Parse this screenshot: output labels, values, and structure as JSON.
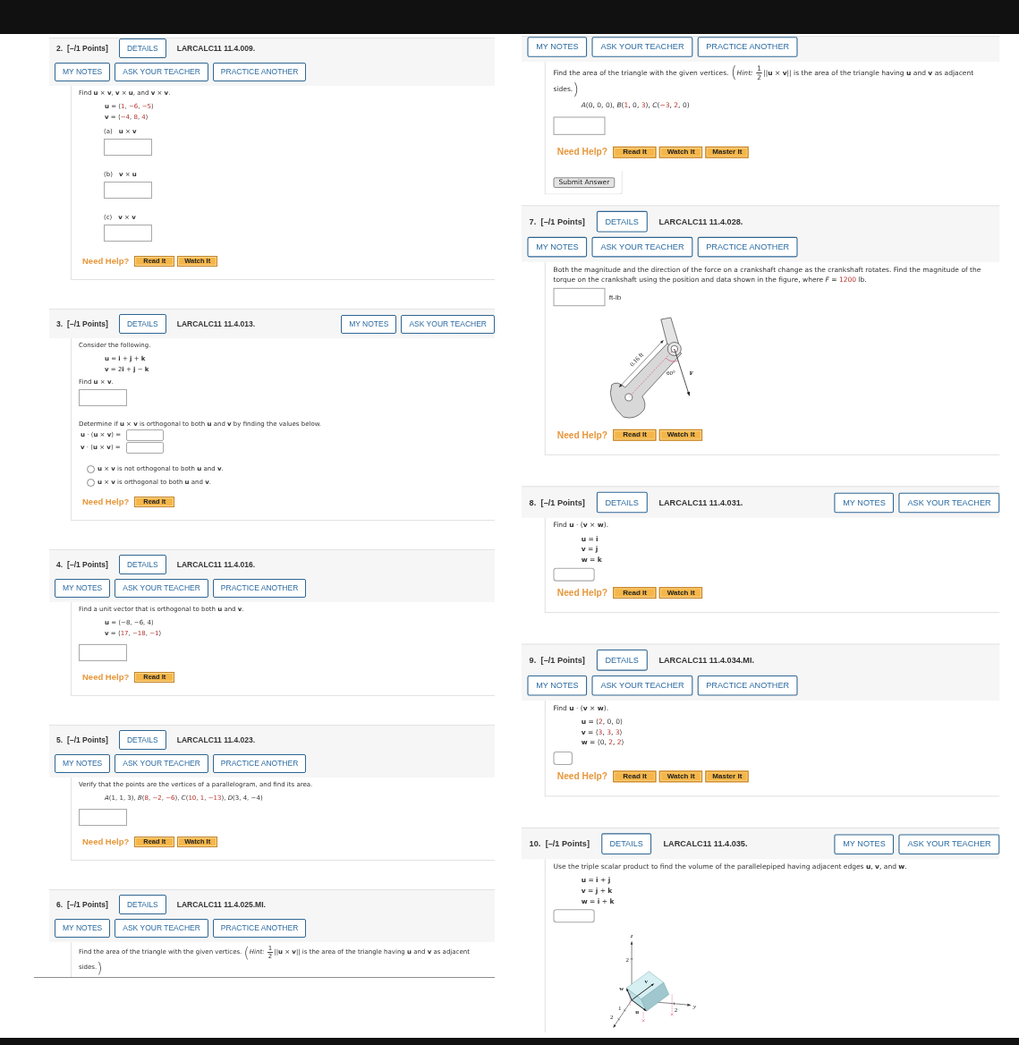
{
  "columns": [
    {
      "questions": [
        {
          "number": "2.",
          "points": "[–/1 Points]",
          "details": "DETAILS",
          "code": "LARCALC11 11.4.009.",
          "actions": [
            "MY NOTES",
            "ASK YOUR TEACHER",
            "PRACTICE ANOTHER"
          ],
          "body": [
            {
              "kind": "text",
              "parts": [
                {
                  "kind": "text",
                  "text": "Find **u** × **v**, **v** × **u**, and **v** × **v**."
                }
              ]
            },
            {
              "kind": "math",
              "lines": [
                [
                  {
                    "kind": "text",
                    "text": "**u** = ⟨"
                  },
                  {
                    "kind": "value",
                    "text": "1"
                  },
                  {
                    "kind": "text",
                    "text": ", "
                  },
                  {
                    "kind": "value",
                    "text": "−6"
                  },
                  {
                    "kind": "text",
                    "text": ", "
                  },
                  {
                    "kind": "value",
                    "text": "−5"
                  },
                  {
                    "kind": "text",
                    "text": "⟩"
                  }
                ],
                [
                  {
                    "kind": "text",
                    "text": "**v** = ⟨"
                  },
                  {
                    "kind": "value",
                    "text": "−4"
                  },
                  {
                    "kind": "text",
                    "text": ", "
                  },
                  {
                    "kind": "value",
                    "text": "8"
                  },
                  {
                    "kind": "text",
                    "text": ", "
                  },
                  {
                    "kind": "value",
                    "text": "4"
                  },
                  {
                    "kind": "text",
                    "text": "⟩"
                  }
                ]
              ]
            },
            {
              "kind": "subpart",
              "label": "(a)",
              "expr": "**u** × **v**"
            },
            {
              "kind": "subpart",
              "label": "(b)",
              "expr": "**v** × **u**"
            },
            {
              "kind": "subpart",
              "label": "(c)",
              "expr": "**v** × **v**"
            }
          ],
          "help": {
            "label": "Need Help?",
            "buttons": [
              "Read It",
              "Watch It"
            ]
          }
        },
        {
          "number": "3.",
          "points": "[–/1 Points]",
          "details": "DETAILS",
          "code": "LARCALC11 11.4.013.",
          "header_actions": [
            "MY NOTES",
            "ASK YOUR TEACHER"
          ],
          "body": [
            {
              "kind": "text",
              "parts": [
                {
                  "kind": "text",
                  "text": "Consider the following."
                }
              ]
            },
            {
              "kind": "math",
              "lines": [
                [
                  {
                    "kind": "text",
                    "text": "**u** = **i** + **j** + **k**"
                  }
                ],
                [
                  {
                    "kind": "text",
                    "text": "**v** = 2**i** + **j** − **k**"
                  }
                ]
              ]
            },
            {
              "kind": "text",
              "parts": [
                {
                  "kind": "text",
                  "text": "Find **u** × **v**."
                }
              ]
            },
            {
              "kind": "answer"
            },
            {
              "kind": "text",
              "parts": [
                {
                  "kind": "text",
                  "text": "Determine if **u** × **v** is orthogonal to both **u** and **v** by finding the values below."
                }
              ]
            },
            {
              "kind": "inline_answer",
              "label": "**u** · (**u** × **v**) ="
            },
            {
              "kind": "inline_answer",
              "label": "**v** · (**u** × **v**) ="
            },
            {
              "kind": "radio",
              "label": "**u** × **v** is not orthogonal to both **u** and **v**.",
              "selected": false
            },
            {
              "kind": "radio",
              "label": "**u** × **v** is orthogonal to both **u** and **v**.",
              "selected": false
            }
          ],
          "help": {
            "label": "Need Help?",
            "buttons": [
              "Read It"
            ]
          }
        },
        {
          "number": "4.",
          "points": "[–/1 Points]",
          "details": "DETAILS",
          "code": "LARCALC11 11.4.016.",
          "actions": [
            "MY NOTES",
            "ASK YOUR TEACHER",
            "PRACTICE ANOTHER"
          ],
          "body": [
            {
              "kind": "text",
              "parts": [
                {
                  "kind": "text",
                  "text": "Find a unit vector that is orthogonal to both **u** and **v**."
                }
              ]
            },
            {
              "kind": "math",
              "lines": [
                [
                  {
                    "kind": "text",
                    "text": "**u** = ⟨−8, −6, 4⟩"
                  }
                ],
                [
                  {
                    "kind": "text",
                    "text": "**v** = ⟨"
                  },
                  {
                    "kind": "value",
                    "text": "17"
                  },
                  {
                    "kind": "text",
                    "text": ", "
                  },
                  {
                    "kind": "value",
                    "text": "−18"
                  },
                  {
                    "kind": "text",
                    "text": ", "
                  },
                  {
                    "kind": "value",
                    "text": "−1"
                  },
                  {
                    "kind": "text",
                    "text": "⟩"
                  }
                ]
              ]
            },
            {
              "kind": "answer"
            }
          ],
          "help": {
            "label": "Need Help?",
            "buttons": [
              "Read It"
            ]
          }
        },
        {
          "number": "5.",
          "points": "[–/1 Points]",
          "details": "DETAILS",
          "code": "LARCALC11 11.4.023.",
          "actions": [
            "MY NOTES",
            "ASK YOUR TEACHER",
            "PRACTICE ANOTHER"
          ],
          "body": [
            {
              "kind": "text",
              "parts": [
                {
                  "kind": "text",
                  "text": "Verify that the points are the vertices of a parallelogram, and find its area."
                }
              ]
            },
            {
              "kind": "math",
              "lines": [
                [
                  {
                    "kind": "text",
                    "text": "*A*(1, 1, 3), *B*("
                  },
                  {
                    "kind": "value",
                    "text": "8"
                  },
                  {
                    "kind": "text",
                    "text": ", "
                  },
                  {
                    "kind": "value",
                    "text": "−2"
                  },
                  {
                    "kind": "text",
                    "text": ", "
                  },
                  {
                    "kind": "value",
                    "text": "−6"
                  },
                  {
                    "kind": "text",
                    "text": "), *C*("
                  },
                  {
                    "kind": "value",
                    "text": "10"
                  },
                  {
                    "kind": "text",
                    "text": ", "
                  },
                  {
                    "kind": "value",
                    "text": "1"
                  },
                  {
                    "kind": "text",
                    "text": ", "
                  },
                  {
                    "kind": "value",
                    "text": "−13"
                  },
                  {
                    "kind": "text",
                    "text": "), *D*(3, 4, −4)"
                  }
                ]
              ]
            },
            {
              "kind": "answer"
            }
          ],
          "help": {
            "label": "Need Help?",
            "buttons": [
              "Read It",
              "Watch It"
            ]
          }
        },
        {
          "number": "6.",
          "points": "[–/1 Points]",
          "details": "DETAILS",
          "code": "LARCALC11 11.4.025.MI.",
          "actions": [
            "MY NOTES",
            "ASK YOUR TEACHER",
            "PRACTICE ANOTHER"
          ],
          "body": [
            {
              "kind": "text",
              "parts": [
                {
                  "kind": "text",
                  "text": "Find the area of the triangle with the given vertices. "
                },
                {
                  "kind": "paren",
                  "text": "("
                },
                {
                  "kind": "text",
                  "text": "*Hint:* "
                },
                {
                  "kind": "frac",
                  "num": "1",
                  "den": "2"
                },
                {
                  "kind": "text",
                  "text": "||**u** × **v**||  is the area of the triangle having **u** and **v** as adjacent sides."
                },
                {
                  "kind": "paren",
                  "text": ")"
                }
              ]
            }
          ]
        }
      ]
    },
    {
      "questions": [
        {
          "actions": [
            "MY NOTES",
            "ASK YOUR TEACHER",
            "PRACTICE ANOTHER"
          ],
          "body": [
            {
              "kind": "text",
              "parts": [
                {
                  "kind": "text",
                  "text": "Find the area of the triangle with the given vertices. "
                },
                {
                  "kind": "paren",
                  "text": "("
                },
                {
                  "kind": "text",
                  "text": "*Hint:* "
                },
                {
                  "kind": "frac",
                  "num": "1",
                  "den": "2"
                },
                {
                  "kind": "text",
                  "text": "||**u** × **v**||  is the area of the triangle having **u** and **v** as adjacent sides."
                },
                {
                  "kind": "paren",
                  "text": ")"
                }
              ]
            },
            {
              "kind": "math",
              "lines": [
                [
                  {
                    "kind": "text",
                    "text": "*A*(0, 0, 0), *B*("
                  },
                  {
                    "kind": "value",
                    "text": "1"
                  },
                  {
                    "kind": "text",
                    "text": ", 0, "
                  },
                  {
                    "kind": "value",
                    "text": "3"
                  },
                  {
                    "kind": "text",
                    "text": "), *C*("
                  },
                  {
                    "kind": "value",
                    "text": "−3"
                  },
                  {
                    "kind": "text",
                    "text": ", "
                  },
                  {
                    "kind": "value",
                    "text": "2"
                  },
                  {
                    "kind": "text",
                    "text": ", 0)"
                  }
                ]
              ]
            },
            {
              "kind": "answer"
            }
          ],
          "help": {
            "label": "Need Help?",
            "buttons": [
              "Read It",
              "Watch It",
              "Master It"
            ]
          },
          "submit": "Submit Answer"
        },
        {
          "number": "7.",
          "points": "[–/1 Points]",
          "details": "DETAILS",
          "code": "LARCALC11 11.4.028.",
          "actions": [
            "MY NOTES",
            "ASK YOUR TEACHER",
            "PRACTICE ANOTHER"
          ],
          "body": [
            {
              "kind": "text",
              "parts": [
                {
                  "kind": "text",
                  "text": "Both the magnitude and the direction of the force on a crankshaft change as the crankshaft rotates. Find the magnitude of the torque on the crankshaft using the position and data shown in the figure, where *F* = "
                },
                {
                  "kind": "value",
                  "text": "1200"
                },
                {
                  "kind": "text",
                  "text": " lb."
                }
              ]
            },
            {
              "kind": "unit_answer",
              "unit": "ft-lb"
            },
            {
              "kind": "crankshaft",
              "labels": [
                "0.16 ft",
                "60°",
                "F"
              ]
            }
          ],
          "help": {
            "label": "Need Help?",
            "buttons": [
              "Read It",
              "Watch It"
            ]
          }
        },
        {
          "number": "8.",
          "points": "[–/1 Points]",
          "details": "DETAILS",
          "code": "LARCALC11 11.4.031.",
          "header_actions": [
            "MY NOTES",
            "ASK YOUR TEACHER"
          ],
          "body": [
            {
              "kind": "text",
              "parts": [
                {
                  "kind": "text",
                  "text": "Find **u** · (**v** × **w**)."
                }
              ]
            },
            {
              "kind": "math",
              "lines": [
                [
                  {
                    "kind": "text",
                    "text": "**u** = **i**"
                  }
                ],
                [
                  {
                    "kind": "text",
                    "text": "**v** = **j**"
                  }
                ],
                [
                  {
                    "kind": "text",
                    "text": "**w** = **k**"
                  }
                ]
              ]
            },
            {
              "kind": "short_answer"
            }
          ],
          "help": {
            "label": "Need Help?",
            "buttons": [
              "Read It",
              "Watch It"
            ]
          }
        },
        {
          "number": "9.",
          "points": "[–/1 Points]",
          "details": "DETAILS",
          "code": "LARCALC11 11.4.034.MI.",
          "actions": [
            "MY NOTES",
            "ASK YOUR TEACHER",
            "PRACTICE ANOTHER"
          ],
          "body": [
            {
              "kind": "text",
              "parts": [
                {
                  "kind": "text",
                  "text": "Find **u** · (**v** × **w**)."
                }
              ]
            },
            {
              "kind": "math",
              "lines": [
                [
                  {
                    "kind": "text",
                    "text": "**u** = ⟨"
                  },
                  {
                    "kind": "value",
                    "text": "2"
                  },
                  {
                    "kind": "text",
                    "text": ", 0, 0⟩"
                  }
                ],
                [
                  {
                    "kind": "text",
                    "text": "**v** = ⟨"
                  },
                  {
                    "kind": "value",
                    "text": "3"
                  },
                  {
                    "kind": "text",
                    "text": ", "
                  },
                  {
                    "kind": "value",
                    "text": "3"
                  },
                  {
                    "kind": "text",
                    "text": ", "
                  },
                  {
                    "kind": "value",
                    "text": "3"
                  },
                  {
                    "kind": "text",
                    "text": "⟩"
                  }
                ],
                [
                  {
                    "kind": "text",
                    "text": "**w** = ⟨0, "
                  },
                  {
                    "kind": "value",
                    "text": "2"
                  },
                  {
                    "kind": "text",
                    "text": ", "
                  },
                  {
                    "kind": "value",
                    "text": "2"
                  },
                  {
                    "kind": "text",
                    "text": "⟩"
                  }
                ]
              ]
            },
            {
              "kind": "tiny_answer"
            }
          ],
          "help": {
            "label": "Need Help?",
            "buttons": [
              "Read It",
              "Watch It",
              "Master It"
            ]
          }
        },
        {
          "number": "10.",
          "points": "[–/1 Points]",
          "details": "DETAILS",
          "code": "LARCALC11 11.4.035.",
          "header_actions": [
            "MY NOTES",
            "ASK YOUR TEACHER"
          ],
          "body": [
            {
              "kind": "text",
              "parts": [
                {
                  "kind": "text",
                  "text": "Use the triple scalar product to find the volume of the parallelepiped having adjacent edges **u**, **v**, and **w**."
                }
              ]
            },
            {
              "kind": "math",
              "lines": [
                [
                  {
                    "kind": "text",
                    "text": "**u** = **i** + **j**"
                  }
                ],
                [
                  {
                    "kind": "text",
                    "text": "**v** = **j** + **k**"
                  }
                ],
                [
                  {
                    "kind": "text",
                    "text": "**w** = **i** + **k**"
                  }
                ]
              ]
            },
            {
              "kind": "short_answer"
            },
            {
              "kind": "parallelepiped",
              "labels": [
                "z",
                "2",
                "w",
                "v",
                "1",
                "u",
                "2",
                "y",
                "2"
              ]
            }
          ]
        }
      ]
    }
  ]
}
